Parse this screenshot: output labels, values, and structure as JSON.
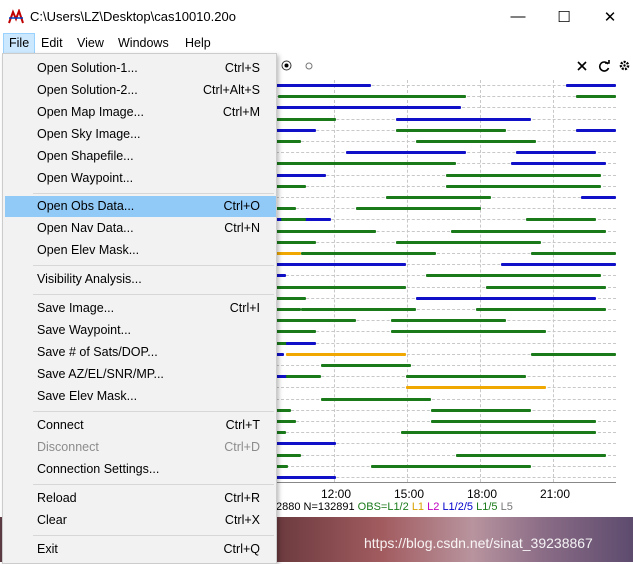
{
  "window": {
    "title": "C:\\Users\\LZ\\Desktop\\cas10010.20o",
    "minimize_glyph": "—",
    "maximize_glyph": "☐",
    "close_glyph": "✕"
  },
  "menubar": {
    "items": [
      "File",
      "Edit",
      "View",
      "Windows",
      "Help"
    ]
  },
  "file_menu": {
    "items": [
      {
        "label": "Open Solution-1...",
        "shortcut": "Ctrl+S"
      },
      {
        "label": "Open Solution-2...",
        "shortcut": "Ctrl+Alt+S"
      },
      {
        "label": "Open Map Image...",
        "shortcut": "Ctrl+M"
      },
      {
        "label": "Open Sky Image...",
        "shortcut": ""
      },
      {
        "label": "Open Shapefile...",
        "shortcut": ""
      },
      {
        "label": "Open Waypoint...",
        "shortcut": ""
      },
      {
        "label": "Open Obs Data...",
        "shortcut": "Ctrl+O"
      },
      {
        "label": "Open Nav Data...",
        "shortcut": "Ctrl+N"
      },
      {
        "label": "Open Elev Mask...",
        "shortcut": ""
      },
      {
        "label": "Visibility Analysis...",
        "shortcut": ""
      },
      {
        "label": "Save Image...",
        "shortcut": "Ctrl+I"
      },
      {
        "label": "Save Waypoint...",
        "shortcut": ""
      },
      {
        "label": "Save # of Sats/DOP...",
        "shortcut": ""
      },
      {
        "label": "Save AZ/EL/SNR/MP...",
        "shortcut": ""
      },
      {
        "label": "Save Elev Mask...",
        "shortcut": ""
      },
      {
        "label": "Connect",
        "shortcut": "Ctrl+T"
      },
      {
        "label": "Disconnect",
        "shortcut": "Ctrl+D"
      },
      {
        "label": "Connection Settings...",
        "shortcut": ""
      },
      {
        "label": "Reload",
        "shortcut": "Ctrl+R"
      },
      {
        "label": "Clear",
        "shortcut": "Ctrl+X"
      },
      {
        "label": "Exit",
        "shortcut": "Ctrl+Q"
      }
    ],
    "highlighted": "Open Obs Data...",
    "disabled": [
      "Disconnect"
    ]
  },
  "plot": {
    "x_ticks": [
      "12:00",
      "15:00",
      "18:00",
      "21:00"
    ],
    "status_prefix": "2880 N=132891",
    "legend": [
      {
        "text": "OBS=L1/2",
        "color": "#1a7a1a"
      },
      {
        "text": "L1",
        "color": "#d9a000"
      },
      {
        "text": "L2",
        "color": "#c000c0"
      },
      {
        "text": "L1/2/5",
        "color": "#0000cc"
      },
      {
        "text": "L1/5",
        "color": "#1a7a1a"
      },
      {
        "text": "L5",
        "color": "#777777"
      }
    ],
    "colors": {
      "green": "#1a7a1a",
      "blue": "#1010c8",
      "orange": "#f0a800"
    }
  },
  "watermark": "https://blog.csdn.net/sinat_39238867"
}
